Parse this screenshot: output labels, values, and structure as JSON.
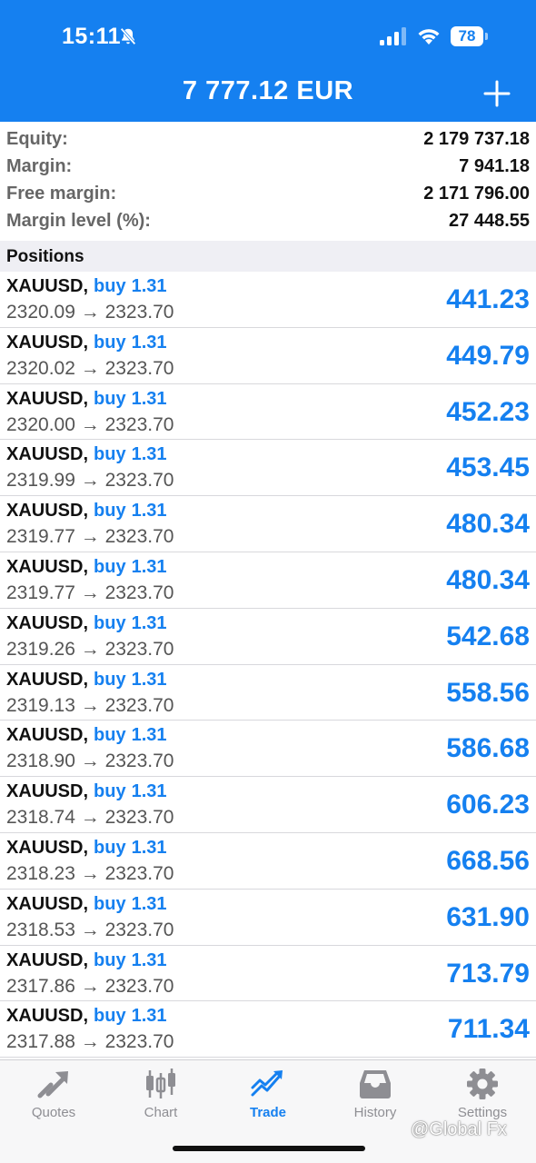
{
  "status_bar": {
    "time": "15:11",
    "battery": "78"
  },
  "header": {
    "balance": "7 777.12 EUR"
  },
  "summary": [
    {
      "label": "Equity:",
      "value": "2 179 737.18"
    },
    {
      "label": "Margin:",
      "value": "7 941.18"
    },
    {
      "label": "Free margin:",
      "value": "2 171 796.00"
    },
    {
      "label": "Margin level (%):",
      "value": "27 448.55"
    }
  ],
  "positions_title": "Positions",
  "positions": [
    {
      "symbol": "XAUUSD",
      "side": "buy",
      "lots": "1.31",
      "prices": "2320.09 → 2323.70",
      "profit": "441.23"
    },
    {
      "symbol": "XAUUSD",
      "side": "buy",
      "lots": "1.31",
      "prices": "2320.02 → 2323.70",
      "profit": "449.79"
    },
    {
      "symbol": "XAUUSD",
      "side": "buy",
      "lots": "1.31",
      "prices": "2320.00 → 2323.70",
      "profit": "452.23"
    },
    {
      "symbol": "XAUUSD",
      "side": "buy",
      "lots": "1.31",
      "prices": "2319.99 → 2323.70",
      "profit": "453.45"
    },
    {
      "symbol": "XAUUSD",
      "side": "buy",
      "lots": "1.31",
      "prices": "2319.77 → 2323.70",
      "profit": "480.34"
    },
    {
      "symbol": "XAUUSD",
      "side": "buy",
      "lots": "1.31",
      "prices": "2319.77 → 2323.70",
      "profit": "480.34"
    },
    {
      "symbol": "XAUUSD",
      "side": "buy",
      "lots": "1.31",
      "prices": "2319.26 → 2323.70",
      "profit": "542.68"
    },
    {
      "symbol": "XAUUSD",
      "side": "buy",
      "lots": "1.31",
      "prices": "2319.13 → 2323.70",
      "profit": "558.56"
    },
    {
      "symbol": "XAUUSD",
      "side": "buy",
      "lots": "1.31",
      "prices": "2318.90 → 2323.70",
      "profit": "586.68"
    },
    {
      "symbol": "XAUUSD",
      "side": "buy",
      "lots": "1.31",
      "prices": "2318.74 → 2323.70",
      "profit": "606.23"
    },
    {
      "symbol": "XAUUSD",
      "side": "buy",
      "lots": "1.31",
      "prices": "2318.23 → 2323.70",
      "profit": "668.56"
    },
    {
      "symbol": "XAUUSD",
      "side": "buy",
      "lots": "1.31",
      "prices": "2318.53 → 2323.70",
      "profit": "631.90"
    },
    {
      "symbol": "XAUUSD",
      "side": "buy",
      "lots": "1.31",
      "prices": "2317.86 → 2323.70",
      "profit": "713.79"
    },
    {
      "symbol": "XAUUSD",
      "side": "buy",
      "lots": "1.31",
      "prices": "2317.88 → 2323.70",
      "profit": "711.34"
    }
  ],
  "tabs": [
    {
      "label": "Quotes",
      "icon": "quotes-icon",
      "active": false
    },
    {
      "label": "Chart",
      "icon": "candlestick-icon",
      "active": false
    },
    {
      "label": "Trade",
      "icon": "trend-icon",
      "active": true
    },
    {
      "label": "History",
      "icon": "inbox-icon",
      "active": false
    },
    {
      "label": "Settings",
      "icon": "gear-icon",
      "active": false
    }
  ],
  "watermark": "@Global Fx",
  "colors": {
    "accent": "#1580f0",
    "header_bg": "#1580f0",
    "label_gray": "#666666",
    "tab_inactive": "#8e8e93"
  }
}
